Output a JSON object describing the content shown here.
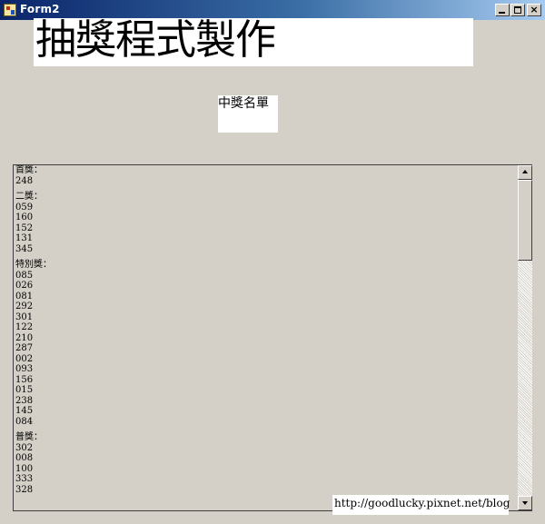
{
  "window": {
    "title": "Form2",
    "controls": {
      "minimize": "minimize",
      "maximize": "maximize",
      "close": "×"
    }
  },
  "header": {
    "title": "抽獎程式製作",
    "winners_label": "中獎名單"
  },
  "results": {
    "groups": [
      {
        "label": "首獎：",
        "numbers": [
          "248"
        ]
      },
      {
        "label": "二獎：",
        "numbers": [
          "059",
          "160",
          "152",
          "131",
          "345"
        ]
      },
      {
        "label": "特別獎：",
        "numbers": [
          "085",
          "026",
          "081",
          "292",
          "301",
          "122",
          "210",
          "287",
          "002",
          "093",
          "156",
          "015",
          "238",
          "145",
          "084"
        ]
      },
      {
        "label": "普獎：",
        "numbers": [
          "302",
          "008",
          "100",
          "333",
          "328"
        ]
      }
    ]
  },
  "footer": {
    "url": "http://goodlucky.pixnet.net/blog"
  },
  "colors": {
    "window_bg": "#d4d0c8",
    "titlebar_start": "#0a246a",
    "titlebar_end": "#a6caf0"
  }
}
